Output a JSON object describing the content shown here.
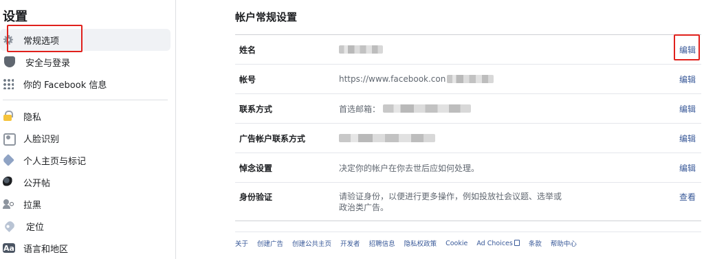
{
  "sidebar": {
    "title": "设置",
    "items": [
      {
        "label": "常规选项",
        "icon": "gear-icon"
      },
      {
        "label": "安全与登录",
        "icon": "shield-icon"
      },
      {
        "label": "你的 Facebook 信息",
        "icon": "grid-icon"
      },
      {
        "label": "隐私",
        "icon": "lock-icon"
      },
      {
        "label": "人脸识别",
        "icon": "face-recognition-icon"
      },
      {
        "label": "个人主页与标记",
        "icon": "tag-icon"
      },
      {
        "label": "公开帖",
        "icon": "globe-icon"
      },
      {
        "label": "拉黑",
        "icon": "block-user-icon"
      },
      {
        "label": "定位",
        "icon": "location-pin-icon"
      },
      {
        "label": "语言和地区",
        "icon": "language-icon",
        "icon_text": "Aa"
      }
    ]
  },
  "main": {
    "title": "帐户常规设置",
    "rows": [
      {
        "label": "姓名",
        "value": "",
        "action": "编辑"
      },
      {
        "label": "帐号",
        "value": "https://www.facebook.con",
        "action": "编辑"
      },
      {
        "label": "联系方式",
        "value": "首选邮箱：",
        "action": "编辑"
      },
      {
        "label": "广告帐户联系方式",
        "value": "",
        "action": "编辑"
      },
      {
        "label": "悼念设置",
        "value": "决定你的帐户在你去世后应如何处理。",
        "action": "编辑"
      },
      {
        "label": "身份验证",
        "value_line1": "请验证身份，以便进行更多操作，例如投放社会议题、选举或",
        "value_line2": "政治类广告。",
        "action": "查看"
      }
    ]
  },
  "footer": {
    "links": [
      "关于",
      "创建广告",
      "创建公共主页",
      "开发者",
      "招聘信息",
      "隐私权政策",
      "Cookie",
      "Ad Choices",
      "条款",
      "帮助中心"
    ]
  },
  "colors": {
    "link": "#385898",
    "highlight_box": "#e0201b",
    "active_bg": "#f0f2f5"
  }
}
